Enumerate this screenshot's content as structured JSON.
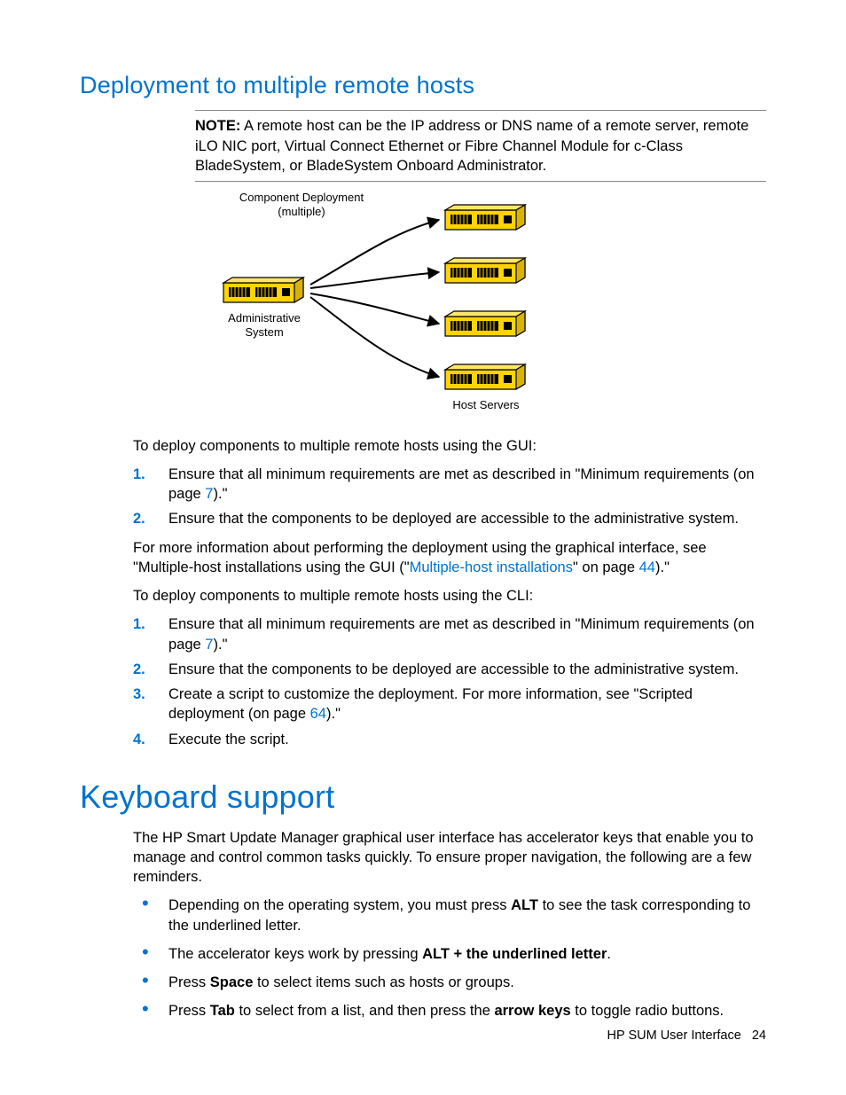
{
  "section1": {
    "heading": "Deployment to multiple remote hosts",
    "note_label": "NOTE:",
    "note_text": "A remote host can be the IP address or DNS name of a remote server, remote iLO NIC port, Virtual Connect Ethernet or Fibre Channel Module for c-Class BladeSystem, or BladeSystem Onboard Administrator.",
    "diagram": {
      "top_label_l1": "Component Deployment",
      "top_label_l2": "(multiple)",
      "left_label_l1": "Administrative",
      "left_label_l2": "System",
      "bottom_label": "Host Servers"
    },
    "gui_intro": "To deploy components to multiple remote hosts using the GUI:",
    "gui_steps": [
      {
        "n": "1.",
        "pre": "Ensure that all minimum requirements are met as described in \"Minimum requirements (on page ",
        "link": "7",
        "post": ").\""
      },
      {
        "n": "2.",
        "text": "Ensure that the components to be deployed are accessible to the administrative system."
      }
    ],
    "more_info_pre": "For more information about performing the deployment using the graphical interface, see \"Multiple-host installations using the GUI (\"",
    "more_info_link1": "Multiple-host installations",
    "more_info_mid": "\" on page ",
    "more_info_link2": "44",
    "more_info_post": ").\"",
    "cli_intro": "To deploy components to multiple remote hosts using the CLI:",
    "cli_steps": [
      {
        "n": "1.",
        "pre": "Ensure that all minimum requirements are met as described in \"Minimum requirements (on page ",
        "link": "7",
        "post": ").\""
      },
      {
        "n": "2.",
        "text": "Ensure that the components to be deployed are accessible to the administrative system."
      },
      {
        "n": "3.",
        "pre": "Create a script to customize the deployment. For more information, see \"Scripted deployment (on page ",
        "link": "64",
        "post": ").\""
      },
      {
        "n": "4.",
        "text": "Execute the script."
      }
    ]
  },
  "section2": {
    "heading": "Keyboard support",
    "intro": "The HP Smart Update Manager graphical user interface has accelerator keys that enable you to manage and control common tasks quickly. To ensure proper navigation, the following are a few reminders.",
    "bullets": [
      {
        "pre": "Depending on the operating system, you must press ",
        "b1": "ALT",
        "post": " to see the task corresponding to the underlined letter."
      },
      {
        "pre": "The accelerator keys work by pressing ",
        "b1": "ALT + the underlined letter",
        "post": "."
      },
      {
        "pre": "Press ",
        "b1": "Space",
        "post": " to select items such as hosts or groups."
      },
      {
        "pre": "Press ",
        "b1": "Tab",
        "mid": " to select from a list, and then press the ",
        "b2": "arrow keys",
        "post": " to toggle radio buttons."
      }
    ]
  },
  "footer": {
    "text": "HP SUM User Interface",
    "page": "24"
  }
}
